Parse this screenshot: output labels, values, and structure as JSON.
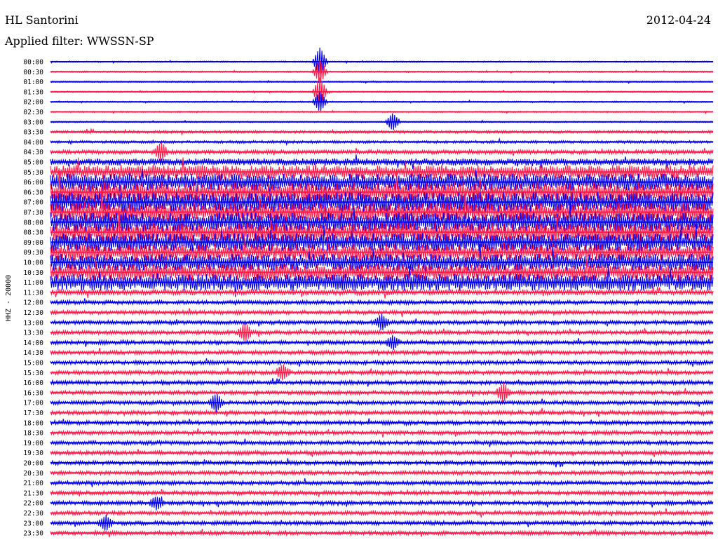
{
  "header": {
    "station": "HL Santorini",
    "date": "2012-04-24",
    "filter": "Applied filter: WWSSN-SP"
  },
  "chart_data": {
    "type": "line",
    "title": "HL Santorini",
    "ylabel": "HHZ - 20000",
    "row_labels": [
      "00:00",
      "00:30",
      "01:00",
      "01:30",
      "02:00",
      "02:30",
      "03:00",
      "03:30",
      "04:00",
      "04:30",
      "05:00",
      "05:30",
      "06:00",
      "06:30",
      "07:00",
      "07:30",
      "08:00",
      "08:30",
      "09:00",
      "09:30",
      "10:00",
      "10:30",
      "11:00",
      "11:30",
      "12:00",
      "12:30",
      "13:00",
      "13:30",
      "14:00",
      "14:30",
      "15:00",
      "15:30",
      "16:00",
      "16:30",
      "17:00",
      "17:30",
      "18:00",
      "18:30",
      "19:00",
      "19:30",
      "20:00",
      "20:30",
      "21:00",
      "21:30",
      "22:00",
      "22:30",
      "23:00",
      "23:30"
    ],
    "series_colors": [
      "#0000ee",
      "#ff1a4a"
    ],
    "amplitude_by_row": [
      1,
      1,
      1,
      1,
      1,
      1,
      1,
      2,
      2,
      3,
      5,
      10,
      12,
      14,
      14,
      14,
      14,
      14,
      13,
      12,
      12,
      12,
      12,
      4,
      3,
      3,
      3,
      3,
      3,
      3,
      3,
      3,
      3,
      3,
      3,
      3,
      3,
      3,
      3,
      3,
      3,
      3,
      3,
      3,
      3,
      3,
      3,
      3
    ],
    "events": [
      {
        "row": 0,
        "minute": 12.2,
        "amplitude": 20
      },
      {
        "row": 1,
        "minute": 12.2,
        "amplitude": 16
      },
      {
        "row": 3,
        "minute": 12.2,
        "amplitude": 20
      },
      {
        "row": 4,
        "minute": 12.2,
        "amplitude": 14
      },
      {
        "row": 6,
        "minute": 15.5,
        "amplitude": 12
      },
      {
        "row": 9,
        "minute": 5.0,
        "amplitude": 12
      },
      {
        "row": 26,
        "minute": 15.0,
        "amplitude": 10
      },
      {
        "row": 27,
        "minute": 8.8,
        "amplitude": 12
      },
      {
        "row": 28,
        "minute": 15.5,
        "amplitude": 9
      },
      {
        "row": 31,
        "minute": 10.5,
        "amplitude": 10
      },
      {
        "row": 33,
        "minute": 20.5,
        "amplitude": 12
      },
      {
        "row": 34,
        "minute": 7.5,
        "amplitude": 12
      },
      {
        "row": 44,
        "minute": 4.8,
        "amplitude": 8
      },
      {
        "row": 46,
        "minute": 2.5,
        "amplitude": 10
      }
    ]
  }
}
